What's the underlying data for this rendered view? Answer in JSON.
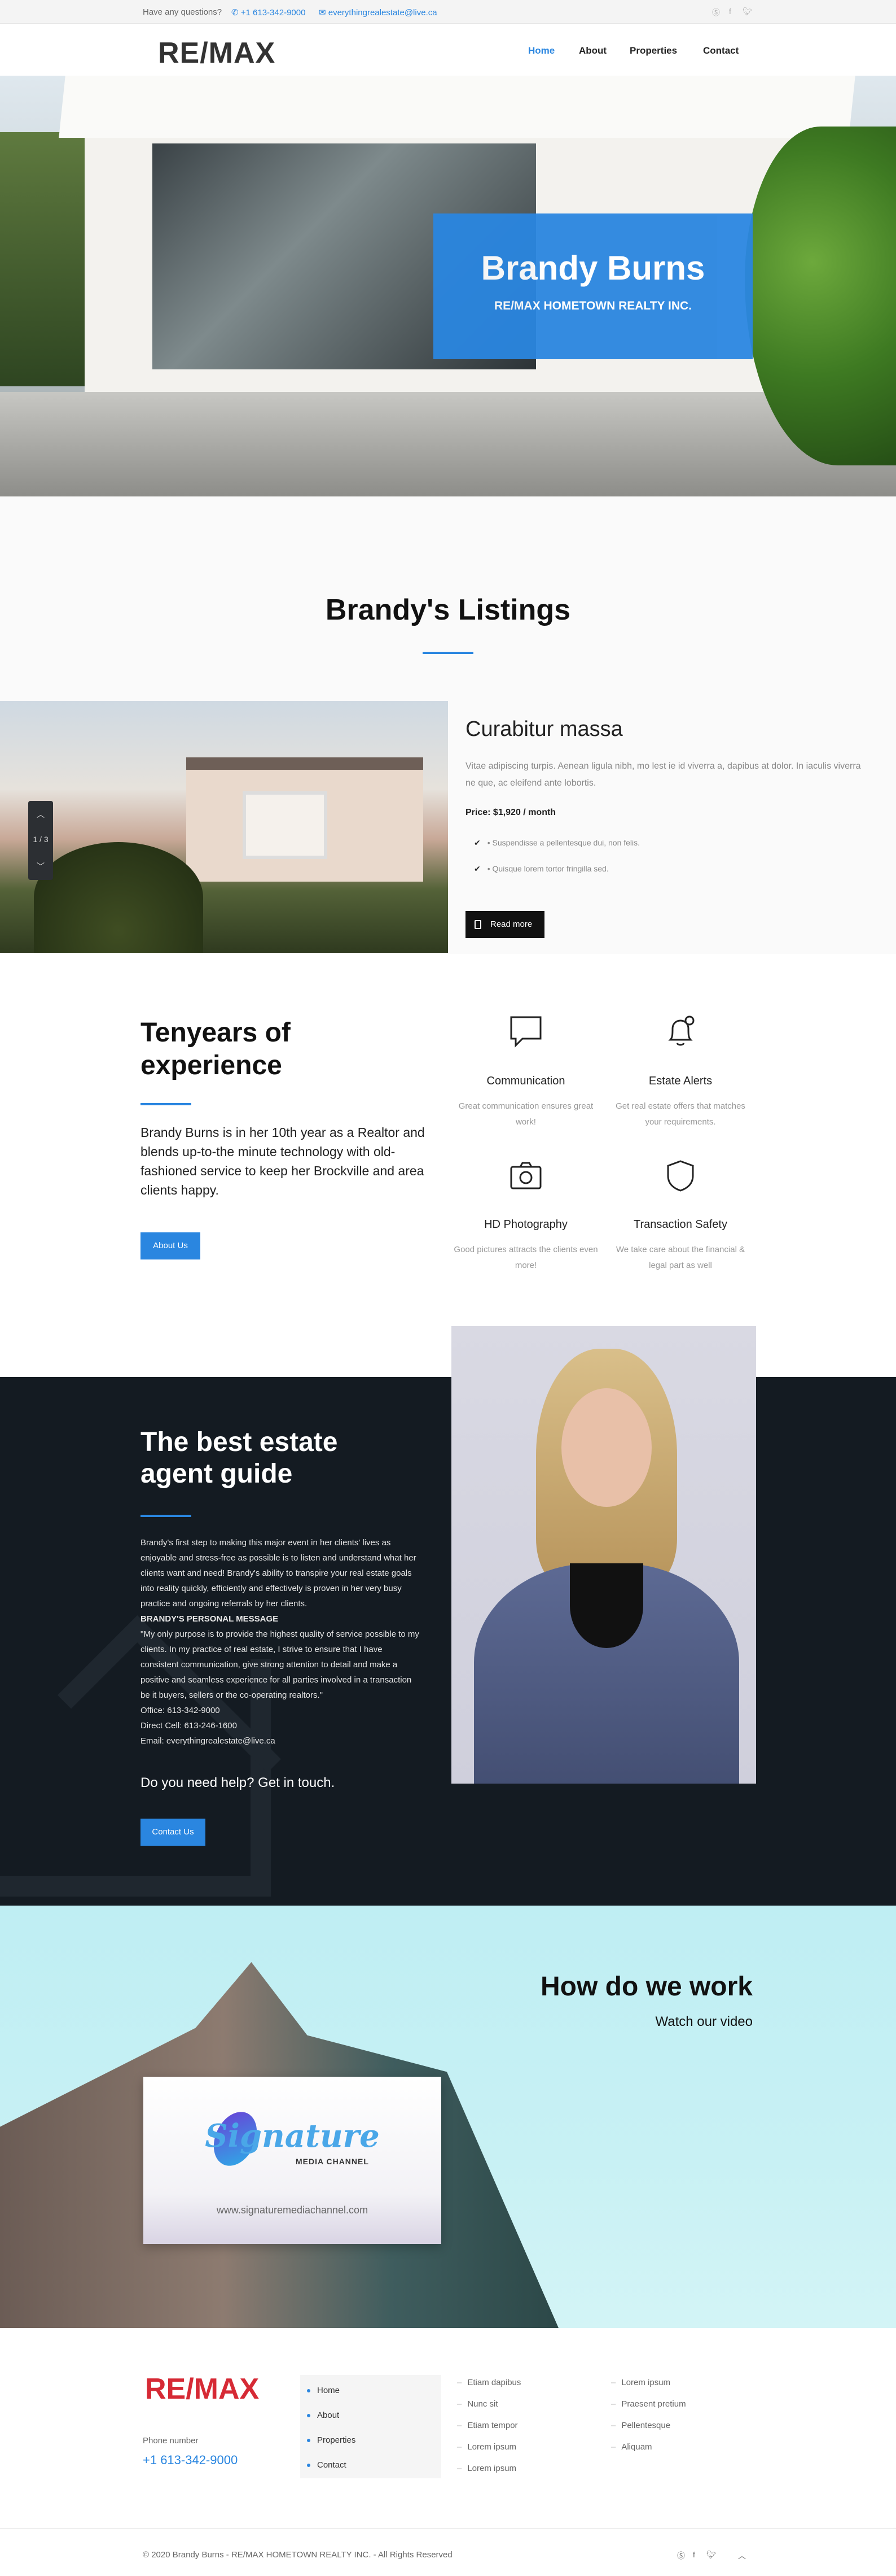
{
  "topbar": {
    "question": "Have any questions?",
    "phone": "+1 613-342-9000",
    "email": "everythingrealestate@live.ca",
    "social_icons": [
      "skype-icon",
      "facebook-icon",
      "twitter-icon"
    ]
  },
  "header": {
    "logo_text": "RE/MAX",
    "nav": [
      "Home",
      "About",
      "Properties",
      "Contact"
    ],
    "active": "Home"
  },
  "hero": {
    "name": "Brandy Burns",
    "company": "RE/MAX HOMETOWN REALTY INC."
  },
  "listings": {
    "title": "Brandy's Listings",
    "slider_position": "1 / 3",
    "item": {
      "title": "Curabitur massa",
      "description": "Vitae adipiscing turpis. Aenean ligula nibh, mo lest ie id viverra a, dapibus at dolor. In iaculis viverra ne que, ac eleifend ante lobortis.",
      "price": "Price: $1,920 / month",
      "features": [
        "Suspendisse a pellentesque dui, non felis.",
        "Quisque lorem tortor fringilla sed."
      ],
      "button": "Read more"
    }
  },
  "experience": {
    "title": "Tenyears of experience",
    "text": "Brandy Burns is in her 10th year as a Realtor and blends up-to-the minute technology with old-fashioned service to keep her Brockville and area clients happy.",
    "button": "About Us",
    "features": [
      {
        "icon": "speech-bubble-icon",
        "title": "Communication",
        "desc": "Great communication ensures great work!"
      },
      {
        "icon": "bell-icon",
        "title": "Estate Alerts",
        "desc": "Get real estate offers that matches your requirements."
      },
      {
        "icon": "camera-icon",
        "title": "HD Photography",
        "desc": "Good pictures attracts the clients even more!"
      },
      {
        "icon": "shield-icon",
        "title": "Transaction Safety",
        "desc": "We take care about the financial & legal part as well"
      }
    ]
  },
  "guide": {
    "title": "The best estate agent guide",
    "paragraph": "Brandy's first step to making this major event in her clients' lives as enjoyable and stress-free as possible is to listen and understand what her clients want and need! Brandy's ability to transpire your real estate goals into reality quickly, efficiently and effectively is proven in her very busy practice and ongoing referrals by her clients.",
    "personal_heading": "BRANDY'S PERSONAL MESSAGE",
    "personal_message": "\"My only purpose is to provide the highest quality of service possible to my clients. In my practice of real estate, I strive to ensure that I have consistent communication, give strong attention to detail and make a positive and seamless experience for all parties involved in a transaction be it buyers, sellers or the co-operating realtors.\"",
    "office": "Office: 613-342-9000",
    "direct": "Direct Cell: 613-246-1600",
    "email": "Email: everythingrealestate@live.ca",
    "help": "Do you need help? Get in touch.",
    "button": "Contact Us"
  },
  "video": {
    "title": "How do we work",
    "subtitle": "Watch our video",
    "card_brand": "Signature",
    "card_sub": "MEDIA CHANNEL",
    "card_url": "www.signaturemediachannel.com"
  },
  "footer": {
    "logo_text": "RE/MAX",
    "phone_label": "Phone number",
    "phone": "+1 613-342-9000",
    "menu": [
      "Home",
      "About",
      "Properties",
      "Contact"
    ],
    "links_col1": [
      "Etiam dapibus",
      "Nunc sit",
      "Etiam tempor",
      "Lorem ipsum",
      "Lorem ipsum"
    ],
    "links_col2": [
      "Lorem ipsum",
      "Praesent pretium",
      "Pellentesque",
      "Aliquam"
    ],
    "copyright": "© 2020 Brandy Burns - RE/MAX HOMETOWN REALTY INC. - All Rights Reserved",
    "social_icons": [
      "skype-icon",
      "facebook-icon",
      "twitter-icon",
      "chevron-up-icon"
    ]
  }
}
